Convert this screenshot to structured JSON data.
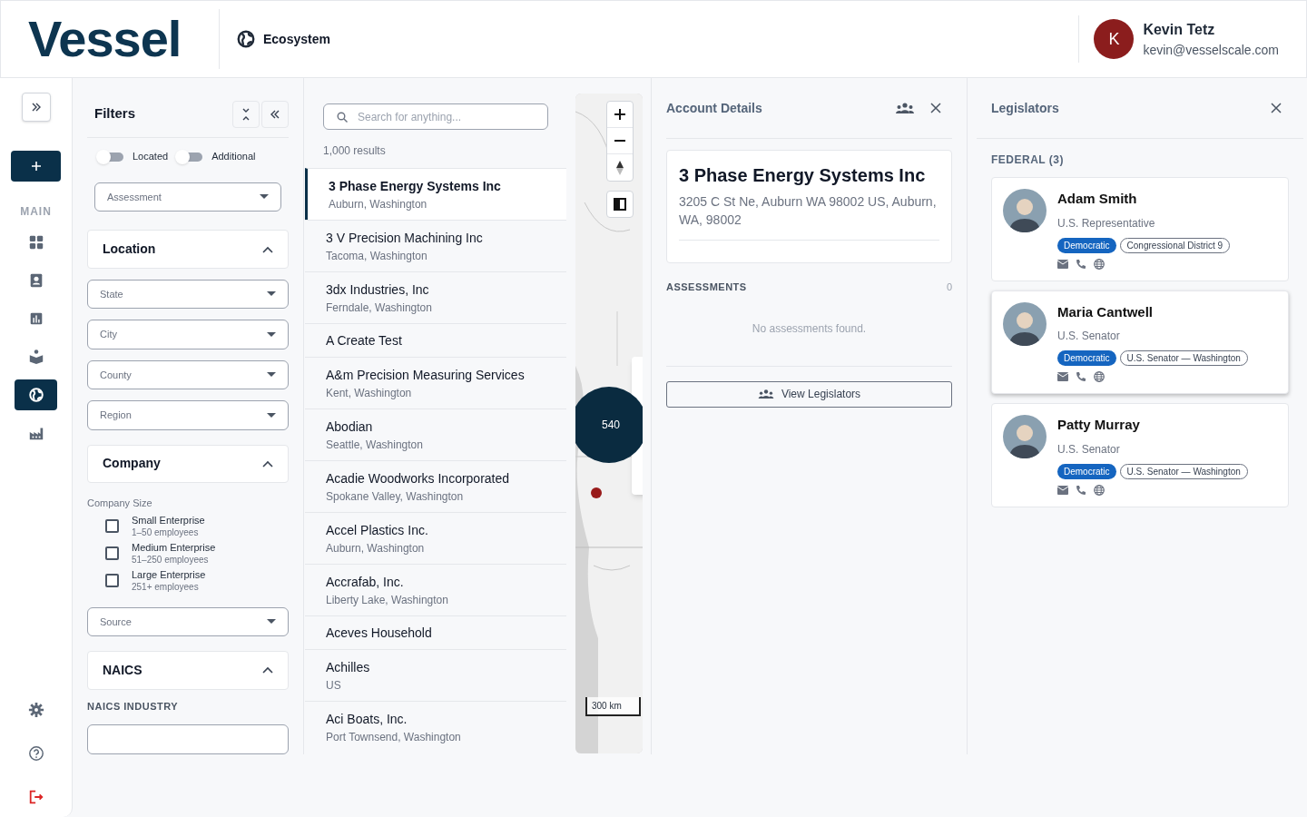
{
  "header": {
    "logo": "Vessel",
    "section": "Ecosystem",
    "user": {
      "initial": "K",
      "name": "Kevin Tetz",
      "email": "kevin@vesselscale.com"
    }
  },
  "rail": {
    "section_label": "MAIN",
    "items": [
      {
        "kind": "dashboard",
        "selected": false
      },
      {
        "kind": "contacts",
        "selected": false
      },
      {
        "kind": "chart",
        "selected": false
      },
      {
        "kind": "reader",
        "selected": false
      },
      {
        "kind": "globe",
        "selected": true
      },
      {
        "kind": "factory",
        "selected": false
      }
    ],
    "bottom": [
      {
        "kind": "settings"
      },
      {
        "kind": "help"
      },
      {
        "kind": "logout"
      }
    ]
  },
  "filters": {
    "title": "Filters",
    "toggles": [
      {
        "label": "Located",
        "on": false
      },
      {
        "label": "Additional",
        "on": false
      }
    ],
    "assessment": {
      "placeholder": "Assessment"
    },
    "location": {
      "title": "Location",
      "expanded": true,
      "selects": [
        {
          "placeholder": "State"
        },
        {
          "placeholder": "City"
        },
        {
          "placeholder": "County"
        },
        {
          "placeholder": "Region"
        }
      ]
    },
    "company": {
      "title": "Company",
      "expanded": true,
      "size_label": "Company Size",
      "sizes": [
        {
          "label": "Small Enterprise",
          "sub": "1–50 employees",
          "checked": false
        },
        {
          "label": "Medium Enterprise",
          "sub": "51–250 employees",
          "checked": false
        },
        {
          "label": "Large Enterprise",
          "sub": "251+ employees",
          "checked": false
        }
      ],
      "source": {
        "placeholder": "Source"
      }
    },
    "naics": {
      "title": "NAICS",
      "expanded": true,
      "industry_label": "NAICS INDUSTRY"
    }
  },
  "results": {
    "search": {
      "placeholder": "Search for anything..."
    },
    "count": "1,000 results",
    "items": [
      {
        "name": "3 Phase Energy Systems Inc",
        "location": "Auburn, Washington",
        "selected": true
      },
      {
        "name": "3 V Precision Machining Inc",
        "location": "Tacoma, Washington",
        "selected": false
      },
      {
        "name": "3dx Industries, Inc",
        "location": "Ferndale, Washington",
        "selected": false
      },
      {
        "name": "A Create Test",
        "selected": false
      },
      {
        "name": "A&m Precision Measuring Services",
        "location": "Kent, Washington",
        "selected": false
      },
      {
        "name": "Abodian",
        "location": "Seattle, Washington",
        "selected": false
      },
      {
        "name": "Acadie Woodworks Incorporated",
        "location": "Spokane Valley, Washington",
        "selected": false
      },
      {
        "name": "Accel Plastics Inc.",
        "location": "Auburn, Washington",
        "selected": false
      },
      {
        "name": "Accrafab, Inc.",
        "location": "Liberty Lake, Washington",
        "selected": false
      },
      {
        "name": "Aceves Household",
        "selected": false
      },
      {
        "name": "Achilles",
        "location": "US",
        "selected": false
      },
      {
        "name": "Aci Boats, Inc.",
        "location": "Port Townsend, Washington",
        "selected": false
      }
    ]
  },
  "map": {
    "cluster": "540",
    "scale": "300 km"
  },
  "account": {
    "title": "Account Details",
    "company": "3 Phase Energy Systems Inc",
    "address": "3205 C St Ne, Auburn WA 98002 US, Auburn, WA, 98002",
    "assessments_label": "ASSESSMENTS",
    "assessments_count": "0",
    "empty": "No assessments found.",
    "button": "View Legislators"
  },
  "legislators": {
    "title": "Legislators",
    "group": "FEDERAL (3)",
    "people": [
      {
        "name": "Adam Smith",
        "role": "U.S. Representative",
        "party": "Democratic",
        "district": "Congressional District 9",
        "selected": false
      },
      {
        "name": "Maria Cantwell",
        "role": "U.S. Senator",
        "party": "Democratic",
        "district": "U.S. Senator — Washington",
        "selected": true
      },
      {
        "name": "Patty Murray",
        "role": "U.S. Senator",
        "party": "Democratic",
        "district": "U.S. Senator — Washington",
        "selected": false
      }
    ]
  }
}
